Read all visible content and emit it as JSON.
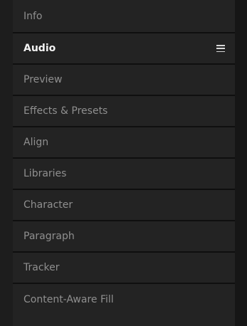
{
  "panels": {
    "items": [
      {
        "label": "Info"
      },
      {
        "label": "Audio"
      },
      {
        "label": "Preview"
      },
      {
        "label": "Effects & Presets"
      },
      {
        "label": "Align"
      },
      {
        "label": "Libraries"
      },
      {
        "label": "Character"
      },
      {
        "label": "Paragraph"
      },
      {
        "label": "Tracker"
      },
      {
        "label": "Content-Aware Fill"
      }
    ],
    "menu_icon": "hamburger-menu-icon"
  },
  "colors": {
    "background": "#1d1d1d",
    "panel": "#232323",
    "separator": "#0f0f0f",
    "inactive_text": "#8f8f8f",
    "active_text": "#f2f2f2"
  }
}
